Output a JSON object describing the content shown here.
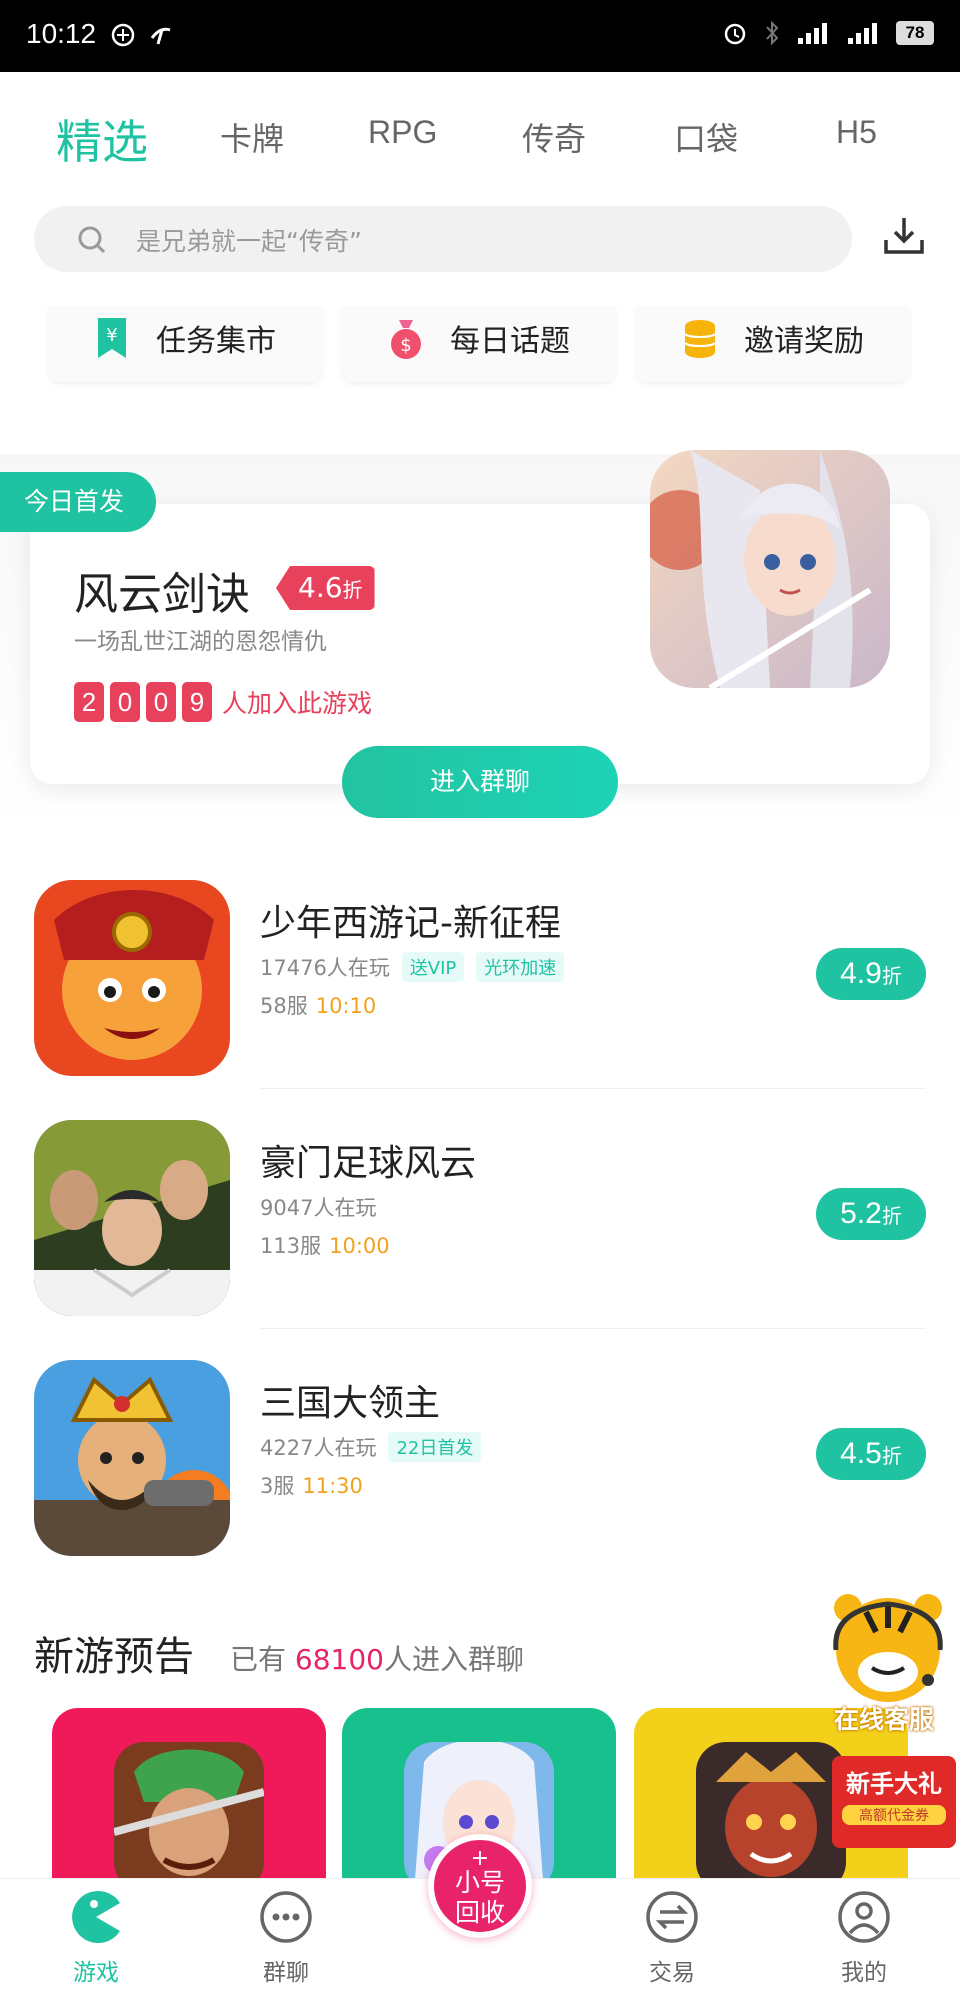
{
  "status_bar": {
    "time": "10:12",
    "battery": "78"
  },
  "tabs": [
    {
      "label": "精选",
      "active": true
    },
    {
      "label": "卡牌"
    },
    {
      "label": "RPG"
    },
    {
      "label": "传奇"
    },
    {
      "label": "口袋"
    },
    {
      "label": "H5"
    }
  ],
  "search": {
    "placeholder": "是兄弟就一起“传奇”"
  },
  "quick_links": [
    {
      "label": "任务集市",
      "icon": "bookmark-yen-icon"
    },
    {
      "label": "每日话题",
      "icon": "money-bag-icon"
    },
    {
      "label": "邀请奖励",
      "icon": "coins-icon"
    }
  ],
  "featured": {
    "badge": "今日首发",
    "title": "风云剑诀",
    "discount": "4.6",
    "discount_unit": "折",
    "subtitle": "一场乱世江湖的恩怨情仇",
    "players_digits": [
      "2",
      "0",
      "0",
      "9"
    ],
    "players_text": "人加入此游戏",
    "button": "进入群聊"
  },
  "games": [
    {
      "name": "少年西游记-新征程",
      "players": "17476人在玩",
      "tags": [
        "送VIP",
        "光环加速"
      ],
      "server": "58服",
      "time": "10:10",
      "discount": "4.9",
      "unit": "折"
    },
    {
      "name": "豪门足球风云",
      "players": "9047人在玩",
      "tags": [],
      "server": "113服",
      "time": "10:00",
      "discount": "5.2",
      "unit": "折"
    },
    {
      "name": "三国大领主",
      "players": "4227人在玩",
      "tags": [
        "22日首发"
      ],
      "server": "3服",
      "time": "11:30",
      "discount": "4.5",
      "unit": "折"
    }
  ],
  "new_games": {
    "title": "新游预告",
    "prefix": "已有",
    "count": "68100",
    "suffix": "人进入群聊"
  },
  "floating": {
    "customer_service": "在线客服",
    "gift_title": "新手大礼",
    "gift_sub": "高额代金券"
  },
  "bottom_nav": [
    {
      "label": "游戏",
      "icon": "pacman-icon",
      "active": true
    },
    {
      "label": "群聊",
      "icon": "chat-dots-icon"
    },
    {
      "label": "小号回收",
      "icon": "plus-icon"
    },
    {
      "label": "交易",
      "icon": "exchange-icon"
    },
    {
      "label": "我的",
      "icon": "user-icon"
    }
  ],
  "center_button": {
    "line1": "小号",
    "line2": "回收",
    "plus": "+"
  },
  "colors": {
    "accent": "#1fc3a2",
    "red": "#e8415c",
    "pink": "#e8236a",
    "orange": "#f0a21d"
  }
}
